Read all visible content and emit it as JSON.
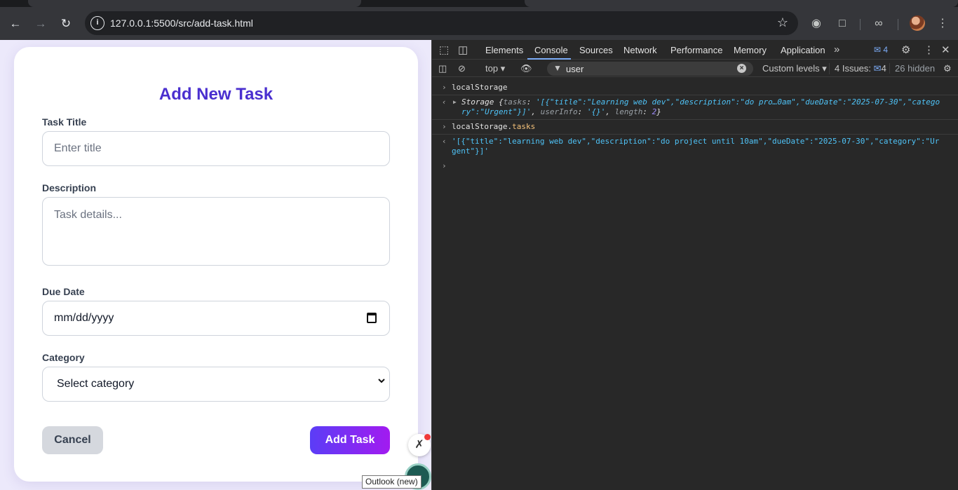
{
  "browser": {
    "url": "127.0.0.1:5500/src/add-task.html"
  },
  "form": {
    "title": "Add New Task",
    "task_title_label": "Task Title",
    "task_title_placeholder": "Enter title",
    "description_label": "Description",
    "description_placeholder": "Task details...",
    "due_date_label": "Due Date",
    "due_date_value": "mm/dd/yyyy",
    "category_label": "Category",
    "category_value": "Select category",
    "cancel_label": "Cancel",
    "submit_label": "Add Task"
  },
  "tooltip": "Outlook (new)",
  "devtools": {
    "tabs": [
      "Elements",
      "Console",
      "Sources",
      "Network",
      "Performance",
      "Memory",
      "Application"
    ],
    "active_tab": "Console",
    "issues_badge": "4",
    "context": "top",
    "filter_value": "user",
    "levels": "Custom levels",
    "issues_label": "4 Issues:",
    "issues_count": "4",
    "hidden_label": "26 hidden",
    "console": {
      "cmd1": "localStorage",
      "out1_line1_prefix": "Storage {",
      "out1_line1_key": "tasks",
      "out1_line1_val": "'[{\"title\":\"Learning web dev\",\"description\":\"do pro…0am\",\"dueDate\":\"2025-07-30\",\"catego",
      "out1_line2_val": "ry\":\"Urgent\"}]'",
      "out1_line2_key2": "userInfo",
      "out1_line2_val2": "'{}'",
      "out1_line2_key3": "length",
      "out1_line2_val3": "2",
      "cmd2_obj": "localStorage.",
      "cmd2_prop": "tasks",
      "out2_line1": "'[{\"title\":\"learning web dev\",\"description\":\"do project until 10am\",\"dueDate\":\"2025-07-30\",\"category\":\"Ur",
      "out2_line2": "gent\"}]'"
    }
  },
  "colors": {
    "heading": "#4a2fcf",
    "add_button_start": "#5b3df6",
    "add_button_end": "#a21bf0",
    "page_bg": "#ece9fb",
    "devtools_bg": "#282828"
  }
}
